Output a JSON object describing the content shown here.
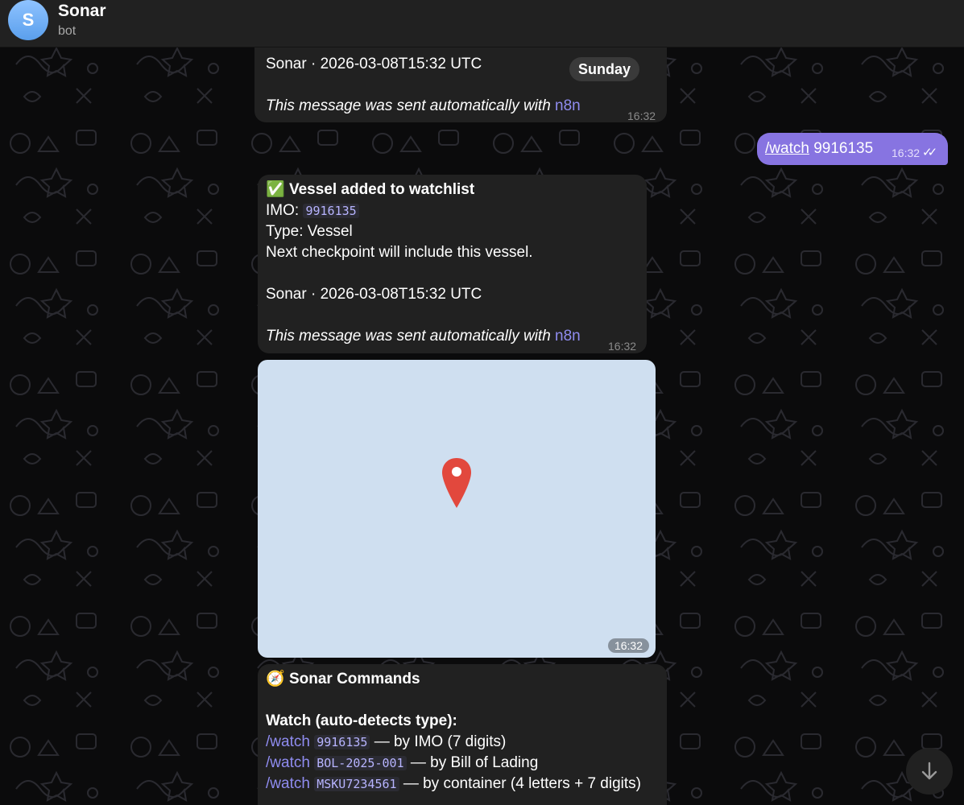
{
  "header": {
    "avatar_letter": "S",
    "name": "Sonar",
    "status": "bot"
  },
  "day_separator": "Sunday",
  "msg1": {
    "signature": "Sonar · 2026-03-08T15:32 UTC",
    "footer_prefix": "This message was sent automatically with ",
    "footer_link": "n8n",
    "time": "16:32"
  },
  "outgoing": {
    "command": "/watch",
    "arg": " 9916135",
    "time": "16:32",
    "status_icon": "double-check-icon"
  },
  "msg2": {
    "title_emoji": "✅",
    "title": "Vessel added to watchlist",
    "imo_label": "IMO: ",
    "imo_value": "9916135",
    "type_line": "Type: Vessel",
    "next_line": "Next checkpoint will include this vessel.",
    "signature": "Sonar · 2026-03-08T15:32 UTC",
    "footer_prefix": "This message was sent automatically with ",
    "footer_link": "n8n",
    "time": "16:32"
  },
  "map_msg": {
    "time": "16:32"
  },
  "msg3": {
    "title_emoji": "🧭",
    "title": "Sonar Commands",
    "section": "Watch (auto-detects type):",
    "commands": [
      {
        "cmd": "/watch",
        "code": "9916135",
        "desc": " — by IMO (7 digits)"
      },
      {
        "cmd": "/watch",
        "code": "BOL-2025-001",
        "desc": " — by Bill of Lading"
      },
      {
        "cmd": "/watch",
        "code": "MSKU7234561",
        "desc": " — by container (4 letters + 7 digits)"
      }
    ]
  },
  "colors": {
    "accent": "#8774e1",
    "bubble": "#212121",
    "link": "#8f8cf0",
    "map": "#cfdff0",
    "pin": "#e2483d"
  }
}
